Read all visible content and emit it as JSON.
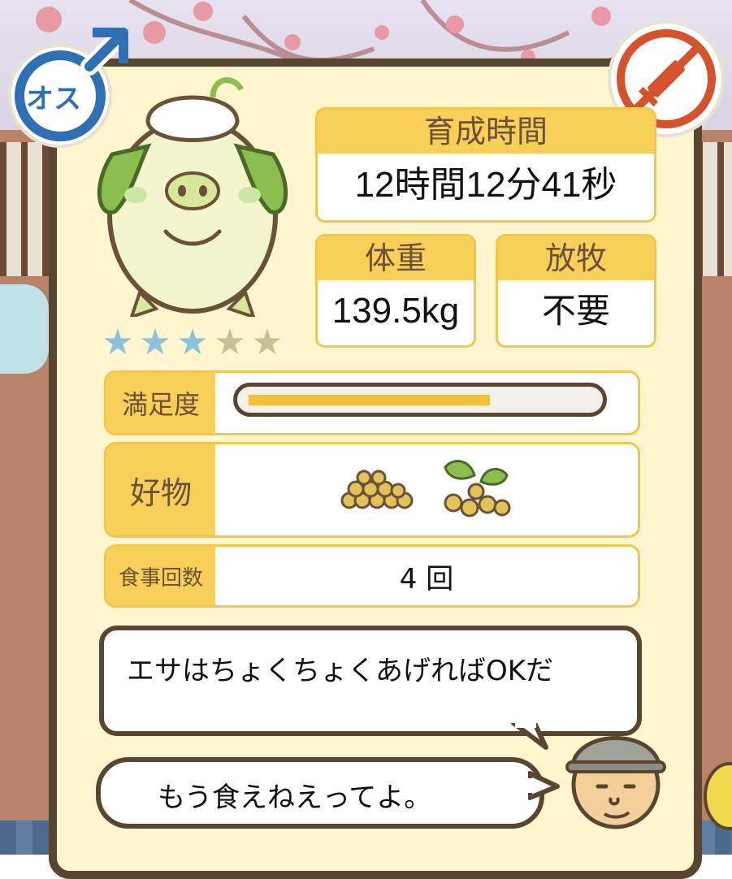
{
  "pig": {
    "gender_label": "オス",
    "star_rating": 3,
    "star_max": 5
  },
  "stats": {
    "raise_time_label": "育成時間",
    "raise_time_value": "12時間12分41秒",
    "weight_label": "体重",
    "weight_value": "139.5kg",
    "grazing_label": "放牧",
    "grazing_value": "不要"
  },
  "satisfaction": {
    "label": "満足度",
    "level": 0.66
  },
  "favorite": {
    "label": "好物",
    "items": [
      "soybean-pile-icon",
      "soybean-plant-icon"
    ]
  },
  "meals": {
    "label": "食事回数",
    "value": "4 回"
  },
  "dialogue": {
    "line1": "エサはちょくちょくあげればOKだ",
    "line2": "もう食えねえってよ。"
  },
  "colors": {
    "panel_bg": "#fff6cf",
    "header_yellow": "#f7cf59",
    "border_brown": "#5a4530",
    "gender_blue": "#2f6fb3",
    "vaccine_red": "#d4532c",
    "star_on": "#8cc3da",
    "star_off": "#cbbf92"
  }
}
